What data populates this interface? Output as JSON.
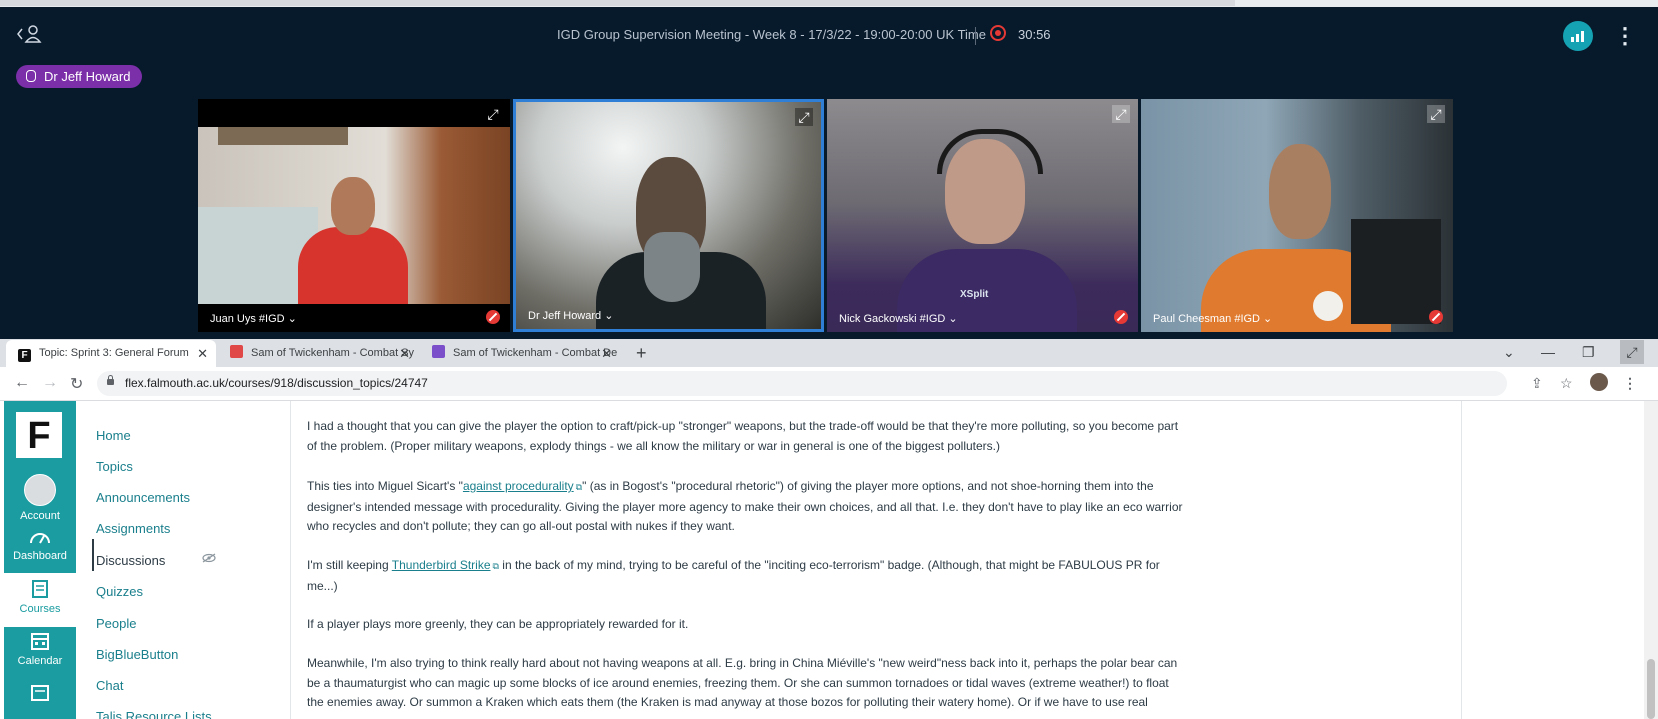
{
  "meeting": {
    "title": "IGD Group Supervision Meeting - Week 8 - 17/3/22 - 19:00-20:00 UK Time",
    "recording_time": "30:56",
    "active_speaker": "Dr Jeff Howard",
    "participants": [
      {
        "name": "Juan Uys #IGD ⌄",
        "muted": true
      },
      {
        "name": "Dr Jeff Howard ⌄",
        "muted": false
      },
      {
        "name": "Nick Gackowski #IGD ⌄",
        "muted": true
      },
      {
        "name": "Paul Cheesman #IGD ⌄",
        "muted": true
      }
    ],
    "xsplit_label": "XSplit"
  },
  "browser": {
    "tabs": [
      {
        "label": "Topic: Sprint 3: General Forum",
        "favicon": "falmouth-icon",
        "color": "#111111"
      },
      {
        "label": "Sam of Twickenham - Combat Sy",
        "favicon": "game-icon",
        "color": "#e04848"
      },
      {
        "label": "Sam of Twickenham - Combat De",
        "favicon": "docs-icon",
        "color": "#7b4fc9"
      }
    ],
    "url": "flex.falmouth.ac.uk/courses/918/discussion_topics/24747"
  },
  "lms": {
    "logo": "F",
    "global_nav": [
      "Account",
      "Dashboard",
      "Courses",
      "Calendar"
    ],
    "course_nav": [
      "Home",
      "Topics",
      "Announcements",
      "Assignments",
      "Discussions",
      "Quizzes",
      "People",
      "BigBlueButton",
      "Chat",
      "Talis Resource Lists"
    ],
    "active_item": "Discussions"
  },
  "post": {
    "p1": "I had a thought that you can give the player the option to craft/pick-up \"stronger\" weapons, but the trade-off would be that they're more polluting, so you become part of the problem. (Proper military weapons, explody things - we all know the military or war in general is one of the biggest polluters.)",
    "p2_before": "This ties into Miguel Sicart's \"",
    "p2_link": "against procedurality",
    "p2_after": "\" (as in Bogost's \"procedural rhetoric\") of giving the player more options, and not shoe-horning them into the designer's intended message with procedurality. Giving the player more agency to make their own choices, and all that. I.e. they don't have to play like an eco warrior who recycles and don't pollute; they can go all-out postal with nukes if they want.",
    "p3_before": "I'm still keeping ",
    "p3_link": "Thunderbird Strike",
    "p3_after": " in the back of my mind, trying to be careful of the \"inciting eco-terrorism\" badge. (Although, that might be FABULOUS PR for me...)",
    "p4": "If a player plays more greenly, they can be appropriately rewarded for it.",
    "p5": "Meanwhile, I'm also trying to think really hard about not having weapons at all. E.g. bring in China Miéville's \"new weird\"ness back into it, perhaps the polar bear can be a thaumaturgist who can magic up some blocks of ice around enemies, freezing them. Or she can summon tornadoes or tidal waves (extreme weather!) to float the enemies away. Or summon a Kraken which eats them (the Kraken is mad anyway at those bozos for polluting their watery home). Or if we have to use real"
  }
}
